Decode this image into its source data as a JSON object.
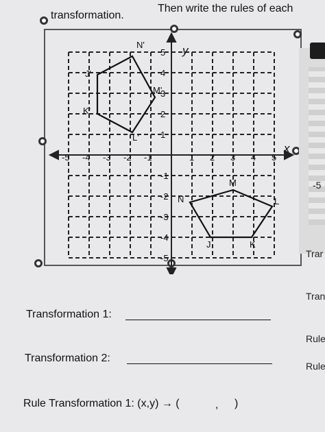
{
  "intro": {
    "line1": "Then write the rules of each",
    "line2": "transformation."
  },
  "graph": {
    "x_axis_label": "x",
    "y_axis_label": "y",
    "x_ticks": [
      "-5",
      "-4",
      "-3",
      "-2",
      "-1",
      "1",
      "2",
      "3",
      "4",
      "5"
    ],
    "y_ticks": [
      "5",
      "4",
      "3",
      "2",
      "1",
      "-1",
      "-2",
      "-3",
      "-4",
      "-5"
    ],
    "prime_labels": [
      "J'",
      "K'",
      "L'",
      "M'",
      "N'"
    ],
    "shape_labels": [
      "J",
      "K",
      "L",
      "M",
      "N"
    ]
  },
  "side_panel": {
    "tick": "-5",
    "label1": "Trar",
    "label2": "Tran",
    "label3": "Rule",
    "label4": "Rule"
  },
  "form": {
    "transformation1_label": "Transformation 1:",
    "transformation2_label": "Transformation 2:",
    "rule1_label": "Rule Transformation 1: (x,y) → (",
    "rule1_comma": ",",
    "rule1_close": ")"
  }
}
